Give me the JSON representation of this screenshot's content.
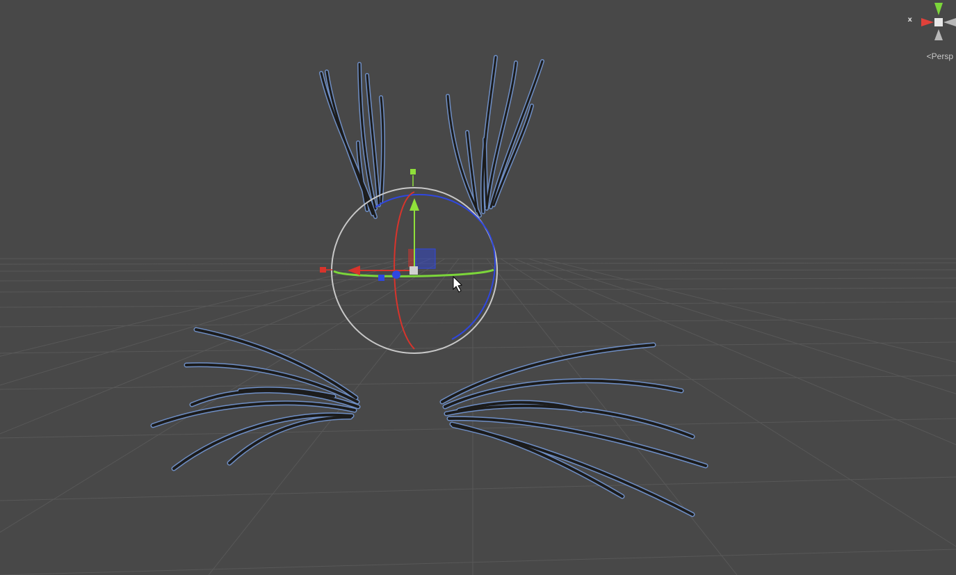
{
  "scene_view": {
    "background": "#484848",
    "grid_color": "#5a5a5a",
    "outline_color": "#6f8fc6",
    "strand_color": "#1c1c1c"
  },
  "gizmo": {
    "projection_label": "Persp",
    "axis_label": "x",
    "x_color": "#e0413a",
    "y_color": "#7cd63a",
    "z_color": "#3a50d8"
  },
  "transform_handles": {
    "x_axis_color": "#d8342c",
    "y_axis_color": "#8fe03a",
    "z_axis_color": "#2f47e0",
    "outer_ring_color": "#c8c8c8"
  }
}
